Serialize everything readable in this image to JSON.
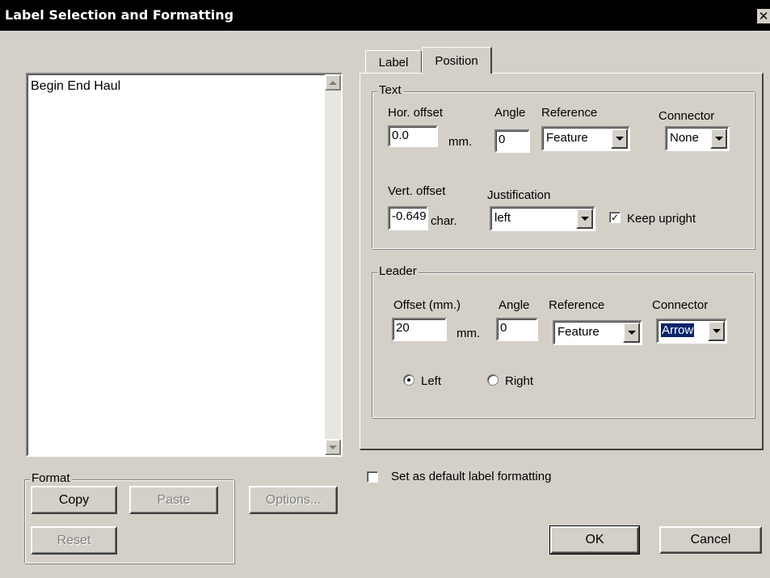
{
  "window": {
    "title": "Label Selection and Formatting",
    "close_glyph": "✕"
  },
  "list": {
    "items": [
      "Begin End Haul"
    ]
  },
  "format_group": {
    "legend": "Format",
    "copy_label": "Copy",
    "paste_label": "Paste",
    "reset_label": "Reset"
  },
  "options_label": "Options...",
  "tabs": [
    {
      "label": "Label",
      "active": false
    },
    {
      "label": "Position",
      "active": true
    }
  ],
  "text_group": {
    "legend": "Text",
    "hor_offset_label": "Hor. offset",
    "hor_offset_value": "0.0",
    "hor_offset_unit": "mm.",
    "angle_label": "Angle",
    "angle_value": "0",
    "reference_label": "Reference",
    "reference_value": "Feature",
    "connector_label": "Connector",
    "connector_value": "None",
    "vert_offset_label": "Vert. offset",
    "vert_offset_value": "-0.649",
    "vert_offset_unit": "char.",
    "justification_label": "Justification",
    "justification_value": "left",
    "keep_upright_label": "Keep upright",
    "keep_upright_checked": true
  },
  "leader_group": {
    "legend": "Leader",
    "offset_label": "Offset (mm.)",
    "offset_value": "20",
    "offset_unit": "mm.",
    "angle_label": "Angle",
    "angle_value": "0",
    "reference_label": "Reference",
    "reference_value": "Feature",
    "connector_label": "Connector",
    "connector_value": "Arrow",
    "side_left_label": "Left",
    "side_right_label": "Right",
    "side_selected": "Left"
  },
  "default_checkbox": {
    "label": "Set as default label formatting",
    "checked": false
  },
  "ok_label": "OK",
  "cancel_label": "Cancel"
}
